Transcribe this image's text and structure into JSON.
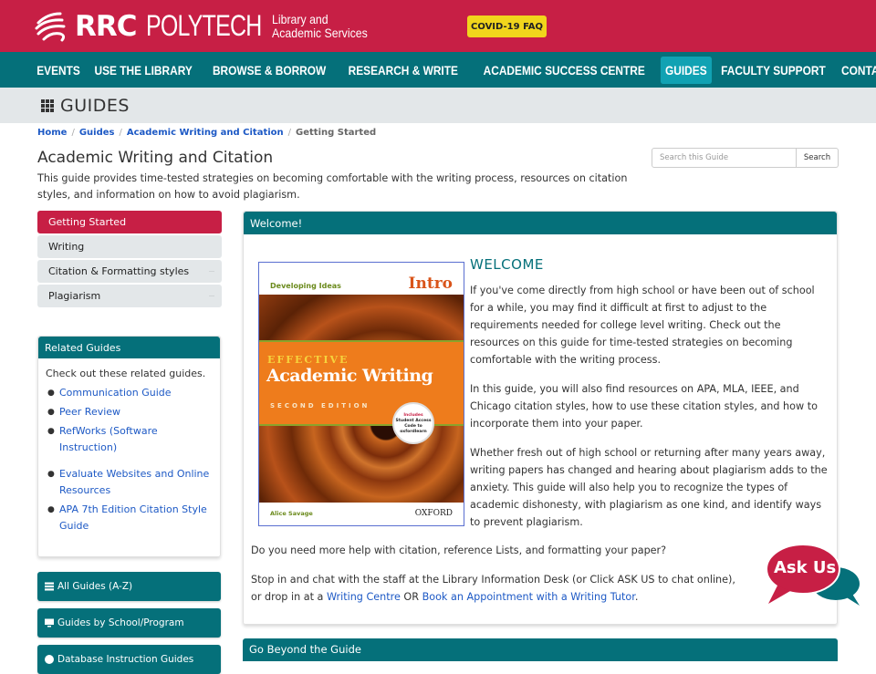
{
  "header": {
    "brand_rrc": "RRC",
    "brand_polytech": "POLYTECH",
    "brand_sub_line1": "Library and",
    "brand_sub_line2": "Academic Services",
    "covid_button": "COVID-19 FAQ"
  },
  "nav": {
    "items": [
      {
        "label": "EVENTS"
      },
      {
        "label": "USE THE LIBRARY"
      },
      {
        "label": "BROWSE & BORROW"
      },
      {
        "label": "RESEARCH & WRITE"
      },
      {
        "label": "ACADEMIC SUCCESS CENTRE"
      },
      {
        "label": "GUIDES",
        "active": true
      },
      {
        "label": "FACULTY SUPPORT"
      },
      {
        "label": "CONTACT"
      }
    ],
    "icons": [
      "search-icon",
      "clock-icon",
      "user-icon",
      "sign-out-icon"
    ]
  },
  "guides_bar": {
    "title": "GUIDES"
  },
  "breadcrumb": {
    "items": [
      "Home",
      "Guides",
      "Academic Writing and Citation"
    ],
    "current": "Getting Started",
    "separator": "/"
  },
  "guide": {
    "title": "Academic Writing and Citation",
    "description": "This guide provides time-tested strategies on becoming comfortable with the writing process, resources on citation styles, and information on how to avoid plagiarism."
  },
  "search": {
    "placeholder": "Search this Guide",
    "value": "",
    "button": "Search"
  },
  "sidebar": {
    "tabs": [
      {
        "label": "Getting Started",
        "active": true
      },
      {
        "label": "Writing"
      },
      {
        "label": "Citation & Formatting styles"
      },
      {
        "label": "Plagiarism"
      }
    ],
    "related": {
      "title": "Related Guides",
      "intro": "Check out these related guides.",
      "links": [
        "Communication Guide",
        "Peer Review",
        "RefWorks (Software Instruction)",
        "Evaluate Websites and Online Resources",
        "APA 7th Edition Citation Style Guide"
      ]
    },
    "buttons": [
      {
        "label": "All Guides (A-Z)",
        "icon": "list-icon"
      },
      {
        "label": "Guides by School/Program",
        "icon": "monitor-icon"
      },
      {
        "label": "Database Instruction Guides",
        "icon": "question-circle-icon"
      }
    ]
  },
  "main": {
    "panel_title": "Welcome!",
    "book": {
      "series": "Developing Ideas",
      "level": "Intro",
      "title_top": "EFFECTIVE",
      "title_main": "Academic Writing",
      "edition": "SECOND EDITION",
      "badge_line1": "Includes",
      "badge_line2": "Student Access",
      "badge_line3": "Code to",
      "badge_line4": "oxfordlearn",
      "author": "Alice Savage",
      "publisher": "OXFORD"
    },
    "heading": "WELCOME",
    "paragraphs": [
      "If you've come directly from high school or have been out of school for a while, you may find it difficult at first to adjust to the requirements needed for college level writing. Check out the resources on this guide for time-tested strategies on becoming comfortable with the writing process.",
      "In this guide, you will also find resources on APA, MLA, IEEE, and Chicago citation styles, how to use these citation styles, and how to incorporate them into your paper.",
      "Whether fresh out of high school or returning after many years away, writing papers has changed and hearing about plagiarism adds to the anxiety. This guide will also help you to recognize the types of academic dishonesty, with plagiarism as one kind, and identify ways to prevent plagiarism.",
      "Do you need more help with citation, reference Lists, and formatting your paper?"
    ],
    "help": {
      "text_before": "Stop in and chat with the staff at the Library Information Desk (or Click ASK US to chat online), or drop in at a ",
      "link1": "Writing Centre",
      "text_mid": " OR ",
      "link2": "Book an Appointment with a Writing Tutor",
      "text_after": "."
    }
  },
  "ask_us": {
    "label": "Ask Us"
  },
  "beyond": {
    "title": "Go Beyond the Guide"
  },
  "colors": {
    "brand_red": "#c71f45",
    "brand_teal": "#05707a",
    "active_nav": "#11a2b3",
    "covid_yellow": "#f1d51c",
    "link_blue": "#1d59c5"
  }
}
